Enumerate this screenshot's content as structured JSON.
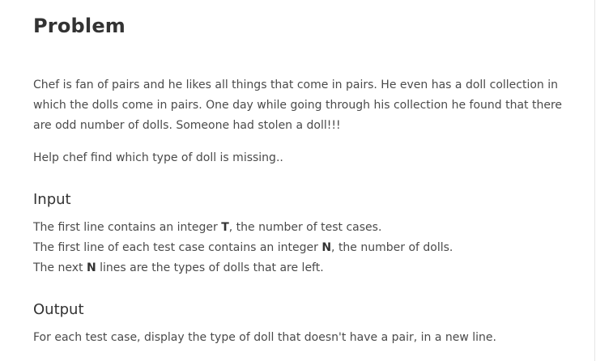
{
  "problem": {
    "title": "Problem",
    "paragraph1": "Chef is fan of pairs and he likes all things that come in pairs. He even has a doll collection in which the dolls come in pairs. One day while going through his collection he found that there are odd number of dolls. Someone had stolen a doll!!!",
    "paragraph2": "Help chef find which type of doll is missing.."
  },
  "input": {
    "heading": "Input",
    "line1": {
      "pre": "The first line contains an integer ",
      "var": "T",
      "post": ", the number of test cases."
    },
    "line2": {
      "pre": "The first line of each test case contains an integer ",
      "var": "N",
      "post": ", the number of dolls."
    },
    "line3": {
      "pre": "The next ",
      "var": "N",
      "post": " lines are the types of dolls that are left."
    }
  },
  "output": {
    "heading": "Output",
    "text": "For each test case, display the type of doll that doesn't have a pair, in a new line."
  }
}
